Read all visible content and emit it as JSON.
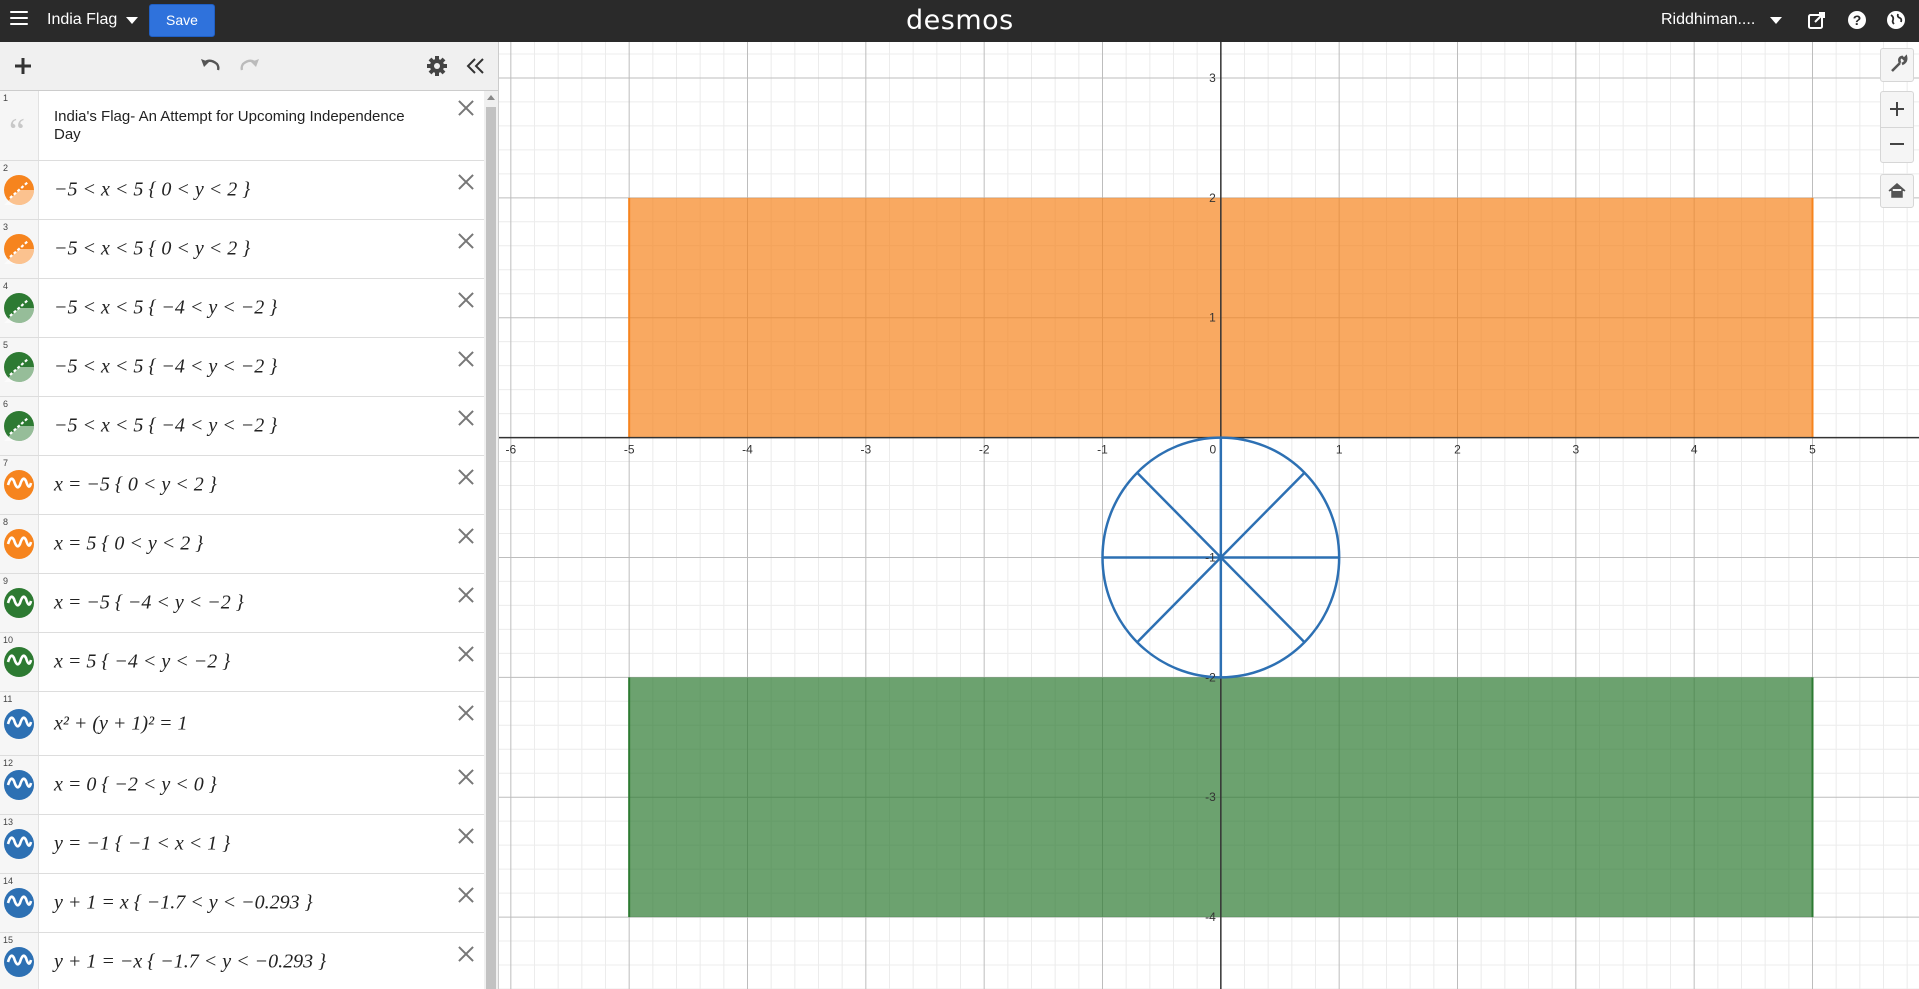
{
  "topbar": {
    "graph_title": "India Flag",
    "save_label": "Save",
    "logo": "desmos",
    "user_name": "Riddhiman...."
  },
  "colors": {
    "orange": "#f6841e",
    "green": "#2d7a32",
    "blue": "#2d70b3",
    "save_button": "#2f72dc"
  },
  "expressions": [
    {
      "num": "1",
      "type": "note",
      "text": "India's Flag- An Attempt for Upcoming Independence Day"
    },
    {
      "num": "2",
      "type": "inequality",
      "color": "orange",
      "text": "−5 < x < 5 { 0 < y < 2 }"
    },
    {
      "num": "3",
      "type": "inequality",
      "color": "orange",
      "text": "−5 < x < 5 { 0 < y < 2 }"
    },
    {
      "num": "4",
      "type": "inequality",
      "color": "green",
      "text": "−5 < x < 5 { −4 < y < −2 }"
    },
    {
      "num": "5",
      "type": "inequality",
      "color": "green",
      "text": "−5 < x < 5 { −4 < y < −2 }"
    },
    {
      "num": "6",
      "type": "inequality",
      "color": "green",
      "text": "−5 < x < 5 { −4 < y < −2 }"
    },
    {
      "num": "7",
      "type": "curve",
      "color": "orange",
      "text": "x = −5 { 0 < y < 2 }"
    },
    {
      "num": "8",
      "type": "curve",
      "color": "orange",
      "text": "x = 5 { 0 < y < 2 }"
    },
    {
      "num": "9",
      "type": "curve",
      "color": "green",
      "text": "x = −5 { −4 < y < −2 }"
    },
    {
      "num": "10",
      "type": "curve",
      "color": "green",
      "text": "x = 5 { −4 < y < −2 }"
    },
    {
      "num": "11",
      "type": "curve",
      "color": "blue",
      "text": "x² + (y + 1)² = 1"
    },
    {
      "num": "12",
      "type": "curve",
      "color": "blue",
      "text": "x = 0 { −2 < y < 0 }"
    },
    {
      "num": "13",
      "type": "curve",
      "color": "blue",
      "text": "y = −1 { −1 < x < 1 }"
    },
    {
      "num": "14",
      "type": "curve",
      "color": "blue",
      "text": "y + 1 = x { −1.7 < y < −0.293 }"
    },
    {
      "num": "15",
      "type": "curve",
      "color": "blue",
      "text": "y + 1 = −x { −1.7 < y < −0.293 }"
    }
  ],
  "graph": {
    "x_range": [
      -6.1,
      5.9
    ],
    "y_range": [
      -4.6,
      3.3
    ],
    "x_tick_labels": [
      "-6",
      "-5",
      "-4",
      "-3",
      "-2",
      "-1",
      "0",
      "1",
      "2",
      "3",
      "4",
      "5"
    ],
    "y_tick_labels": [
      "3",
      "2",
      "1",
      "-1",
      "-2",
      "-3",
      "-4"
    ],
    "regions": [
      {
        "color": "orange",
        "x": [
          -5,
          5
        ],
        "y": [
          0,
          2
        ]
      },
      {
        "color": "green",
        "x": [
          -5,
          5
        ],
        "y": [
          -4,
          -2
        ]
      }
    ],
    "circle": {
      "color": "blue",
      "center": [
        0,
        -1
      ],
      "radius": 1
    }
  }
}
